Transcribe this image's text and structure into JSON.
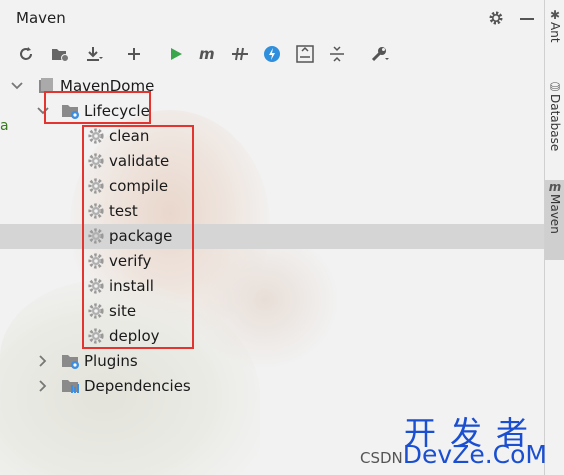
{
  "panel": {
    "title": "Maven"
  },
  "toolbar": {
    "tools": [
      "reload-icon",
      "folder-add-icon",
      "download-icon",
      "add-icon",
      "run-icon",
      "maven-m-icon",
      "toggle-offline-icon",
      "lightning-icon",
      "collapse-all-icon",
      "expand-all-icon",
      "wrench-icon"
    ]
  },
  "tree": {
    "root": {
      "label": "MavenDome"
    },
    "lifecycle": {
      "label": "Lifecycle",
      "phases": [
        "clean",
        "validate",
        "compile",
        "test",
        "package",
        "verify",
        "install",
        "site",
        "deploy"
      ],
      "selected": "package"
    },
    "plugins": {
      "label": "Plugins"
    },
    "dependencies": {
      "label": "Dependencies"
    }
  },
  "sidebar": {
    "tabs": [
      {
        "label": "Ant"
      },
      {
        "label": "Database"
      },
      {
        "label": "Maven"
      }
    ]
  },
  "watermark": {
    "cn": "开发者",
    "csdn": "CSDN",
    "brand": "DevZe.CoM"
  },
  "colors": {
    "highlight": "#e3342f",
    "run": "#3aa64b",
    "lightning": "#2f8fdc",
    "selection": "#d5d5d5"
  }
}
